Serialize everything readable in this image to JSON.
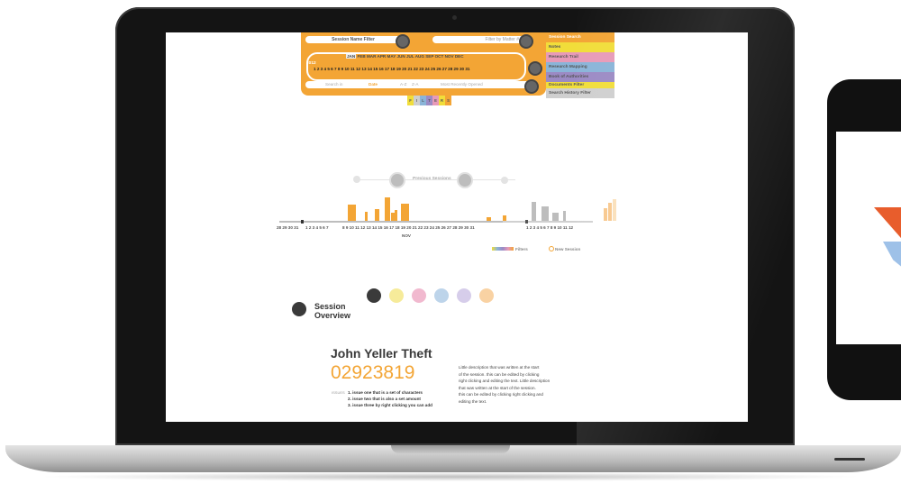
{
  "filter_bar": {
    "session_name_filter": "Session Name Filter",
    "filter_by_matter": "Filter by Matter #",
    "year": "2012",
    "months": [
      "JAN",
      "FEB",
      "MAR",
      "APR",
      "MAY",
      "JUN",
      "JUL",
      "AUG",
      "SEP",
      "OCT",
      "NOV",
      "DEC"
    ],
    "days": "1 2 3 4 5 6 7 8 9 10 11 12 13 14 15 16 17 18 19 20 21 22 23 24 25 26 27 28 29 30 31",
    "sort_options": [
      "Search in",
      "Date",
      "A-Z",
      "Z-A",
      "Most Recently Opened"
    ],
    "filter_tab_letters": [
      "F",
      "I",
      "L",
      "T",
      "E",
      "R",
      "S"
    ]
  },
  "side_tabs": [
    {
      "label": "Session Search",
      "color": "#f3a535"
    },
    {
      "label": "Notes",
      "color": "#f1dd3a"
    },
    {
      "label": "Research Trail",
      "color": "#e79ab8"
    },
    {
      "label": "Research Mapping",
      "color": "#8ab4d8"
    },
    {
      "label": "Book of Authorities",
      "color": "#9b8ac4"
    },
    {
      "label": "Documents Filter",
      "color": "#f1dd3a"
    },
    {
      "label": "Search History Filter",
      "color": "#cfcfcf"
    }
  ],
  "timeline": {
    "previous_sessions": "Previous Sessions",
    "left_days": "28 29 30 31",
    "nov_days_a": "1 2 3 4 5 6 7",
    "nov_days_b": "8 9 10 11 12 13 14 15 16 17 18 19 20 21 22 23 24 25 26 27 28 29 30 31",
    "right_days": "1 2 3 4 5 6 7 8 9 10 11 12",
    "month_label": "NOV",
    "legend_filters": "Filters",
    "legend_new_session": "New Session"
  },
  "chart_data": {
    "type": "bar",
    "title": "",
    "xlabel": "NOV",
    "ylabel": "",
    "series": [
      {
        "values": [
          0,
          0,
          0,
          0,
          0,
          0,
          0,
          0,
          0,
          0,
          0,
          0,
          0,
          0,
          0,
          0,
          0,
          0,
          0,
          0,
          0,
          0,
          0,
          0,
          0,
          0,
          0,
          0,
          0,
          0,
          0,
          0,
          0,
          0,
          0,
          0,
          0,
          0,
          0,
          0,
          0,
          0,
          0,
          0,
          0,
          0,
          0,
          0,
          0,
          0,
          0,
          0,
          0,
          0,
          0
        ]
      }
    ]
  },
  "overview": {
    "section_title": "Session Overview",
    "session_name": "John Yeller Theft",
    "session_number": "02923819",
    "issues_label": "ISSUES",
    "issues": [
      "1. issue one that is a set of characters",
      "2. issue two that is also a set amount",
      "3. issue three by right clicking you can add"
    ],
    "description": [
      "Little description that was written at the start",
      "of the session. this can be edited by clicking",
      "right clicking and editing the text. Little description",
      "that was written at the start of the session.",
      "this can be edited by clicking right clicking and",
      "editing the text."
    ]
  }
}
